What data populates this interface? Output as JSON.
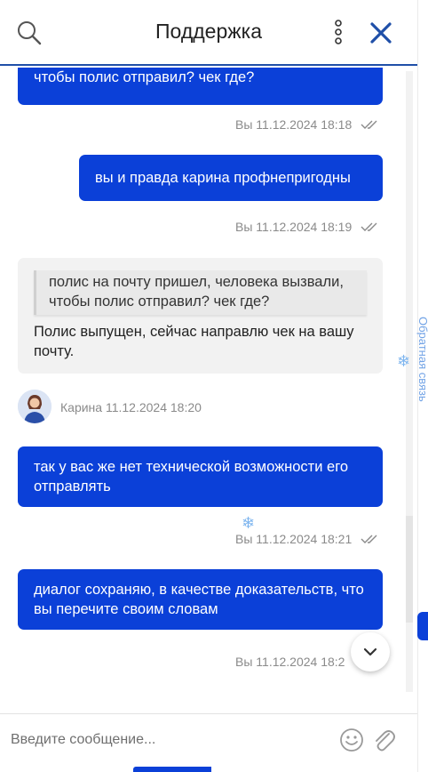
{
  "header": {
    "title": "Поддержка"
  },
  "messages": {
    "m1": {
      "text": "чтобы полис отправил? чек где?",
      "meta": "Вы 11.12.2024 18:18"
    },
    "m2": {
      "text": "вы и правда карина профнепригодны",
      "meta": "Вы 11.12.2024 18:19"
    },
    "m3": {
      "quote": "полис на почту пришел, человека вызвали, чтобы полис отправил? чек где?",
      "text": "Полис выпущен, сейчас направлю чек на вашу почту."
    },
    "agent": {
      "label": "Карина 11.12.2024 18:20"
    },
    "m4": {
      "text": "так у вас же нет технической возможности его отправлять",
      "meta": "Вы 11.12.2024 18:21"
    },
    "m5": {
      "text": "диалог сохраняю, в качестве доказательств, что вы перечите своим словам",
      "meta": "Вы 11.12.2024 18:2"
    }
  },
  "composer": {
    "placeholder": "Введите сообщение..."
  },
  "side": {
    "text": "Обратная связь"
  },
  "icons": {
    "search": "search-icon",
    "more": "more-vertical-icon",
    "close": "close-icon",
    "read": "double-check-icon",
    "scroll_down": "chevron-down-icon",
    "emoji": "smile-icon",
    "attach": "paperclip-icon"
  },
  "colors": {
    "accent": "#0b40d8",
    "header_line": "#1f4fa8",
    "incoming": "#f2f2f2",
    "meta": "#8a8a8a"
  }
}
